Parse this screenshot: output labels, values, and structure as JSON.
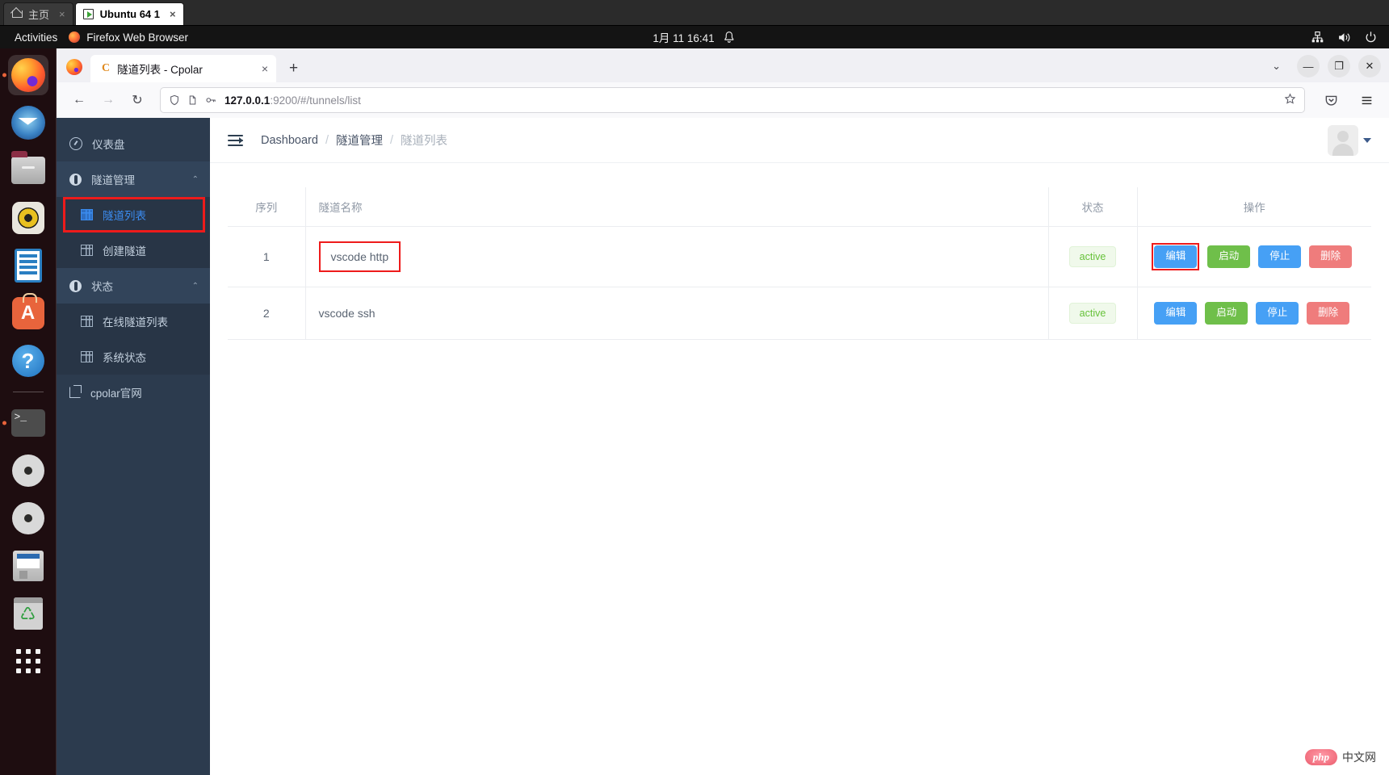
{
  "vmware": {
    "tabs": [
      {
        "label": "主页",
        "icon": "home-icon",
        "active": false
      },
      {
        "label": "Ubuntu 64 1",
        "icon": "virtual-machine-icon",
        "active": true
      }
    ],
    "close_glyph": "×"
  },
  "gnome": {
    "activities": "Activities",
    "app_name": "Firefox Web Browser",
    "clock": "1月 11  16:41",
    "icons": [
      "bell-icon",
      "network-icon",
      "volume-icon",
      "power-icon"
    ]
  },
  "dock": {
    "items": [
      {
        "name": "firefox",
        "running": true,
        "focused": true
      },
      {
        "name": "thunderbird",
        "running": false,
        "focused": false
      },
      {
        "name": "files",
        "running": false,
        "focused": false
      },
      {
        "name": "rhythmbox",
        "running": false,
        "focused": false
      },
      {
        "name": "libreoffice-writer",
        "running": false,
        "focused": false
      },
      {
        "name": "ubuntu-software",
        "running": false,
        "focused": false,
        "glyph": "A"
      },
      {
        "name": "help",
        "running": false,
        "focused": false,
        "glyph": "?"
      },
      {
        "name": "terminal",
        "running": true,
        "focused": false,
        "glyph": ">_"
      },
      {
        "name": "disc-1",
        "running": false,
        "focused": false
      },
      {
        "name": "disc-2",
        "running": false,
        "focused": false
      },
      {
        "name": "floppy-disk",
        "running": false,
        "focused": false
      },
      {
        "name": "trash",
        "running": false,
        "focused": false
      },
      {
        "name": "show-applications",
        "running": false,
        "focused": false
      }
    ]
  },
  "browser": {
    "tab": {
      "favicon_letter": "C",
      "title": "隧道列表 - Cpolar",
      "close_glyph": "×"
    },
    "new_tab_glyph": "+",
    "window_controls": {
      "tab_list": "⌄",
      "minimize": "—",
      "maximize": "❐",
      "close": "✕"
    },
    "nav": {
      "back": "←",
      "forward": "→",
      "reload": "↻"
    },
    "url": {
      "host": "127.0.0.1",
      "rest": ":9200/#/tunnels/list",
      "full": "127.0.0.1:9200/#/tunnels/list"
    },
    "urlbar_icons": [
      "shield-icon",
      "page-info-icon",
      "key-icon",
      "bookmark-star-icon"
    ],
    "toolbar_right": [
      "pocket-icon",
      "app-menu-icon"
    ]
  },
  "sidebar": {
    "items": [
      {
        "label": "仪表盘",
        "icon": "dashboard-icon",
        "type": "link",
        "indent": 0
      },
      {
        "label": "隧道管理",
        "icon": "tunnel-icon",
        "type": "group",
        "expanded": true,
        "chevron": "⌃"
      },
      {
        "label": "隧道列表",
        "icon": "grid-icon",
        "type": "child",
        "active": true,
        "highlighted": true
      },
      {
        "label": "创建隧道",
        "icon": "grid-icon",
        "type": "child",
        "active": false
      },
      {
        "label": "状态",
        "icon": "status-icon",
        "type": "group",
        "expanded": true,
        "chevron": "⌃"
      },
      {
        "label": "在线隧道列表",
        "icon": "grid-icon",
        "type": "child",
        "active": false
      },
      {
        "label": "系统状态",
        "icon": "grid-icon",
        "type": "child",
        "active": false
      },
      {
        "label": "cpolar官网",
        "icon": "external-link-icon",
        "type": "link",
        "indent": 0
      }
    ]
  },
  "main": {
    "collapse_icon": "menu-fold-icon",
    "breadcrumb": [
      {
        "label": "Dashboard",
        "current": false
      },
      {
        "label": "隧道管理",
        "current": false
      },
      {
        "label": "隧道列表",
        "current": true
      }
    ],
    "breadcrumb_separator": "/",
    "avatar": "user-avatar",
    "table": {
      "columns": [
        "序列",
        "隧道名称",
        "状态",
        "操作"
      ],
      "rows": [
        {
          "seq": "1",
          "name": "vscode http",
          "name_highlighted": true,
          "status": "active",
          "actions": [
            {
              "label": "编辑",
              "color": "blue",
              "highlighted": true
            },
            {
              "label": "启动",
              "color": "green",
              "highlighted": false
            },
            {
              "label": "停止",
              "color": "blue",
              "highlighted": false
            },
            {
              "label": "删除",
              "color": "red",
              "highlighted": false
            }
          ]
        },
        {
          "seq": "2",
          "name": "vscode ssh",
          "name_highlighted": false,
          "status": "active",
          "actions": [
            {
              "label": "编辑",
              "color": "blue",
              "highlighted": false
            },
            {
              "label": "启动",
              "color": "green",
              "highlighted": false
            },
            {
              "label": "停止",
              "color": "blue",
              "highlighted": false
            },
            {
              "label": "删除",
              "color": "red",
              "highlighted": false
            }
          ]
        }
      ]
    }
  },
  "watermark": {
    "brand": "php",
    "suffix": "中文网"
  },
  "colors": {
    "sidebar_bg": "#2c3b4e",
    "sidebar_child_bg": "#283546",
    "accent_blue": "#46a0f5",
    "accent_green": "#6fbf4a",
    "accent_red": "#ef7c7c",
    "status_green_text": "#67c23a",
    "annotation_red": "#ee1b1b",
    "active_link_blue": "#3b8cf0"
  }
}
